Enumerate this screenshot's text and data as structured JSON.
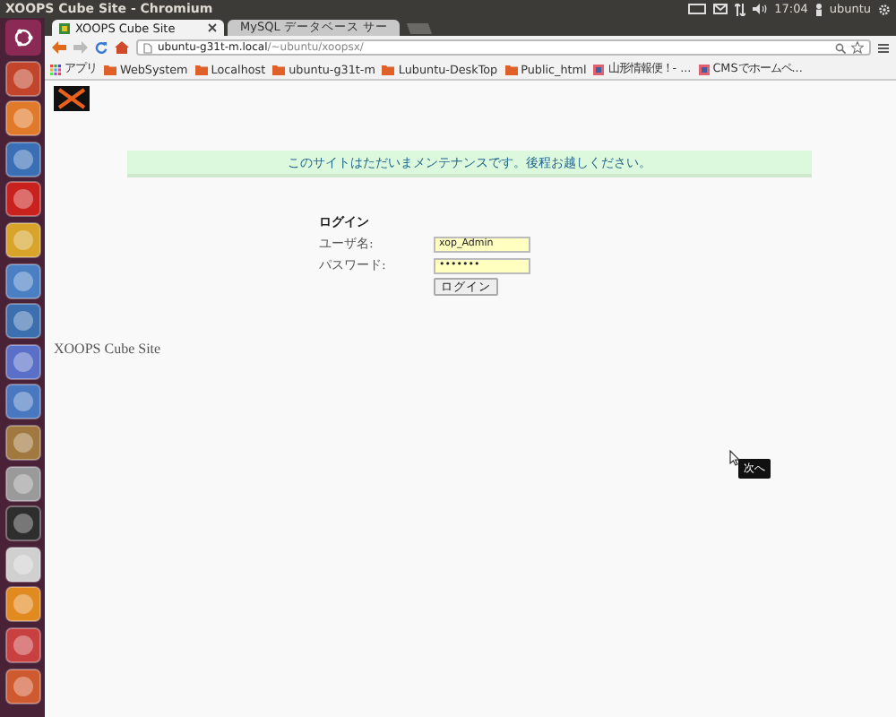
{
  "top_panel": {
    "title": "XOOPS Cube Site - Chromium",
    "clock": "17:04",
    "user": "ubuntu"
  },
  "launcher": {
    "items": [
      {
        "color": "#c2442a"
      },
      {
        "color": "#e07a2a"
      },
      {
        "color": "#3a6fb5"
      },
      {
        "color": "#c9211e"
      },
      {
        "color": "#d8a42a"
      },
      {
        "color": "#4a7fc4"
      },
      {
        "color": "#3c6fb0"
      },
      {
        "color": "#5a6fc8"
      },
      {
        "color": "#4a78c0"
      },
      {
        "color": "#a07840"
      },
      {
        "color": "#9a9a9a"
      },
      {
        "color": "#2e2e2e"
      },
      {
        "color": "#d0d0d0"
      },
      {
        "color": "#e08a20"
      },
      {
        "color": "#c84040"
      },
      {
        "color": "#d05a30"
      }
    ]
  },
  "tabs": [
    {
      "label": "XOOPS Cube Site",
      "selected": true
    },
    {
      "label": "MySQL データベース サー",
      "selected": false
    }
  ],
  "address": {
    "host": "ubuntu-g31t-m.local",
    "path": "/~ubuntu/xoopsx/"
  },
  "bookmarks": [
    {
      "label": "アプリ",
      "kind": "apps"
    },
    {
      "label": "WebSystem",
      "kind": "folder"
    },
    {
      "label": "Localhost",
      "kind": "folder"
    },
    {
      "label": "ubuntu-g31t-m",
      "kind": "folder"
    },
    {
      "label": "Lubuntu-DeskTop",
      "kind": "folder"
    },
    {
      "label": "Public_html",
      "kind": "folder"
    },
    {
      "label": "山形情報便！- ...",
      "kind": "page"
    },
    {
      "label": "CMSでホームペ...",
      "kind": "page"
    }
  ],
  "page": {
    "notice": "このサイトはただいまメンテナンスです。後程お越しください。",
    "login": {
      "title": "ログイン",
      "user_label": "ユーザ名:",
      "user_value": "xop_Admin",
      "password_label": "パスワード:",
      "password_value": "•••••••",
      "button": "ログイン"
    },
    "footer": "XOOPS Cube Site",
    "tooltip": "次へ"
  }
}
